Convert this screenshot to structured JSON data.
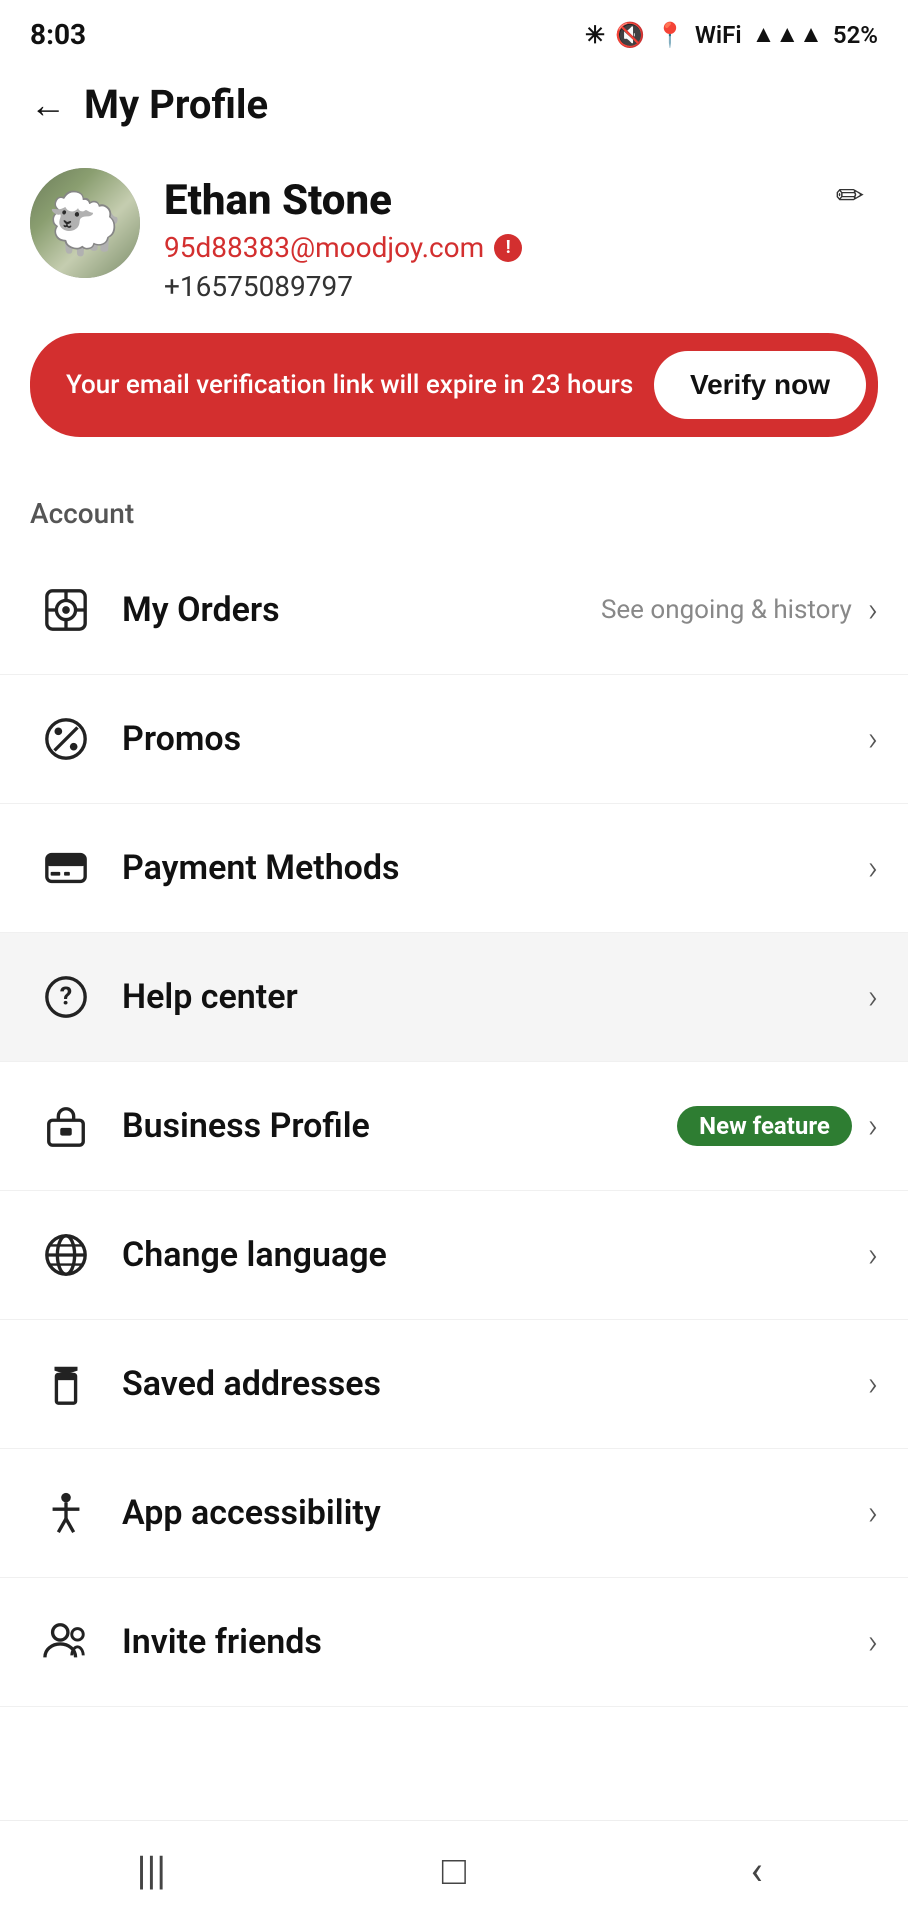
{
  "statusBar": {
    "time": "8:03",
    "battery": "52%",
    "signal": "●●●●"
  },
  "header": {
    "backLabel": "←",
    "title": "My Profile"
  },
  "profile": {
    "name": "Ethan Stone",
    "email": "95d88383@moodjoy.com",
    "phone": "+16575089797",
    "editLabel": "✏"
  },
  "verifyBanner": {
    "text": "Your email verification link will expire in 23 hours",
    "buttonLabel": "Verify now"
  },
  "accountSection": {
    "label": "Account"
  },
  "menuItems": [
    {
      "id": "my-orders",
      "label": "My Orders",
      "sublabel": "See ongoing & history",
      "badge": null,
      "icon": "orders"
    },
    {
      "id": "promos",
      "label": "Promos",
      "sublabel": null,
      "badge": null,
      "icon": "promos"
    },
    {
      "id": "payment-methods",
      "label": "Payment Methods",
      "sublabel": null,
      "badge": null,
      "icon": "payment"
    },
    {
      "id": "help-center",
      "label": "Help center",
      "sublabel": null,
      "badge": null,
      "icon": "help",
      "highlighted": true
    },
    {
      "id": "business-profile",
      "label": "Business Profile",
      "sublabel": null,
      "badge": "New feature",
      "icon": "business"
    },
    {
      "id": "change-language",
      "label": "Change language",
      "sublabel": null,
      "badge": null,
      "icon": "language"
    },
    {
      "id": "saved-addresses",
      "label": "Saved addresses",
      "sublabel": null,
      "badge": null,
      "icon": "addresses"
    },
    {
      "id": "app-accessibility",
      "label": "App accessibility",
      "sublabel": null,
      "badge": null,
      "icon": "accessibility"
    },
    {
      "id": "invite-friends",
      "label": "Invite friends",
      "sublabel": null,
      "badge": null,
      "icon": "friends"
    }
  ],
  "bottomNav": {
    "buttons": [
      "|||",
      "□",
      "<"
    ]
  },
  "chevron": "›"
}
